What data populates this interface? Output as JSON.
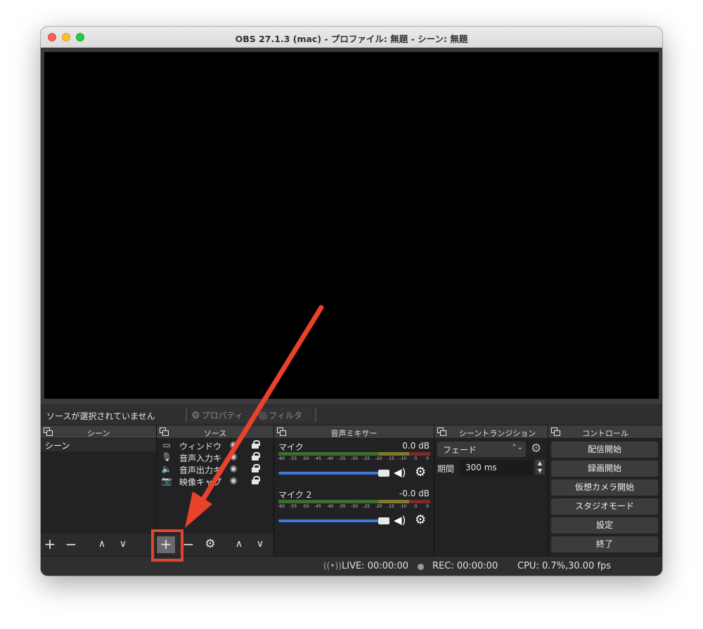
{
  "window": {
    "title": "OBS 27.1.3 (mac) - プロファイル: 無題 - シーン: 無題"
  },
  "source_toolbar": {
    "no_source_text": "ソースが選択されていません",
    "properties_label": "プロパティ",
    "filters_label": "フィルタ"
  },
  "scenes": {
    "title": "シーン",
    "items": [
      {
        "label": "シーン"
      }
    ],
    "footer": {
      "add": "+",
      "remove": "−",
      "up": "∧",
      "down": "∨"
    }
  },
  "sources": {
    "title": "ソース",
    "items": [
      {
        "icon": "window-icon",
        "label": "ウィンドウ"
      },
      {
        "icon": "microphone-icon",
        "label": "音声入力キ"
      },
      {
        "icon": "speaker-icon",
        "label": "音声出力キ"
      },
      {
        "icon": "camera-icon",
        "label": "映像キャプ"
      }
    ],
    "footer": {
      "add": "+",
      "remove": "−",
      "settings": "⚙",
      "up": "∧",
      "down": "∨"
    }
  },
  "mixer": {
    "title": "音声ミキサー",
    "channels": [
      {
        "name": "マイク",
        "db": "0.0 dB",
        "level": 0.95
      },
      {
        "name": "マイク 2",
        "db": "-0.0 dB",
        "level": 0.95
      }
    ],
    "ticks": [
      "-60",
      "-55",
      "-50",
      "-45",
      "-40",
      "-35",
      "-30",
      "-25",
      "-20",
      "-15",
      "-10",
      "-5",
      "0"
    ]
  },
  "transitions": {
    "title": "シーントランジション",
    "selected": "フェード",
    "duration_label": "期間",
    "duration_value": "300 ms"
  },
  "controls": {
    "title": "コントロール",
    "buttons": [
      "配信開始",
      "録画開始",
      "仮想カメラ開始",
      "スタジオモード",
      "設定",
      "終了"
    ]
  },
  "status": {
    "live": "LIVE: 00:00:00",
    "rec": "REC: 00:00:00",
    "cpu": "CPU: 0.7%,30.00 fps"
  },
  "annotation": {
    "arrow_color": "#e8412c",
    "highlight_color": "#e8412c"
  }
}
